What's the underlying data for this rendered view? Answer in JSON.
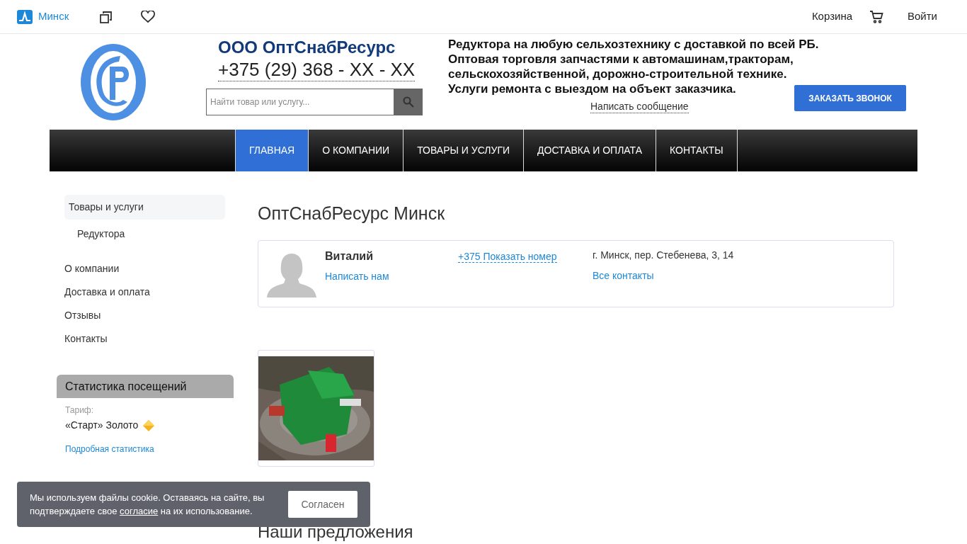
{
  "top_bar": {
    "city": "Минск",
    "cart": "Корзина",
    "login": "Войти"
  },
  "company": {
    "name": "ООО ОптСнабРесурс",
    "phone": "+375 (29) 368 - XX - XX"
  },
  "search": {
    "placeholder": "Найти товар или услугу..."
  },
  "slogan": [
    "Редуктора на любую сельхозтехнику с доставкой по всей РБ.",
    "Оптовая торговля запчастями к автомашинам,тракторам,",
    "сельскохозяйственной, дорожно-строительной технике.",
    "Услуги ремонта с выездом на объект заказчика."
  ],
  "message_link": "Написать сообщение",
  "callback_button": "ЗАКАЗАТЬ ЗВОНОК",
  "nav": [
    {
      "label": "ГЛАВНАЯ",
      "selected": true
    },
    {
      "label": "О КОМПАНИИ",
      "selected": false
    },
    {
      "label": "ТОВАРЫ И УСЛУГИ",
      "selected": false
    },
    {
      "label": "ДОСТАВКА И ОПЛАТА",
      "selected": false
    },
    {
      "label": "КОНТАКТЫ",
      "selected": false
    }
  ],
  "sidebar": {
    "items": [
      {
        "label": "Товары и услуги",
        "selected": true,
        "children": [
          {
            "label": "Редуктора",
            "selected": false
          }
        ]
      },
      {
        "label": "О компании",
        "selected": false
      },
      {
        "label": "Доставка и оплата",
        "selected": false
      },
      {
        "label": "Отзывы",
        "selected": false
      },
      {
        "label": "Контакты",
        "selected": false
      }
    ]
  },
  "stats": {
    "title": "Статистика посещений",
    "tariff_label": "Тариф:",
    "tariff": "«Старт» Золото",
    "link": "Подробная статистика"
  },
  "page_title": "ОптСнабРесурс Минск",
  "contact": {
    "name": "Виталий",
    "write": "Написать нам",
    "phone": "+375 Показать номер",
    "address": "г. Минск, пер. Стебенева, 3, 14",
    "all": "Все контакты"
  },
  "products": [
    {
      "kind": "picture"
    }
  ],
  "section_title": "Наши предложения",
  "cookie": {
    "text": "Мы используем файлы cookie. Оставаясь на сайте, вы подтверждаете свое ",
    "link": "согласие",
    "text_end": " на их использование.",
    "button": "Согласен"
  }
}
